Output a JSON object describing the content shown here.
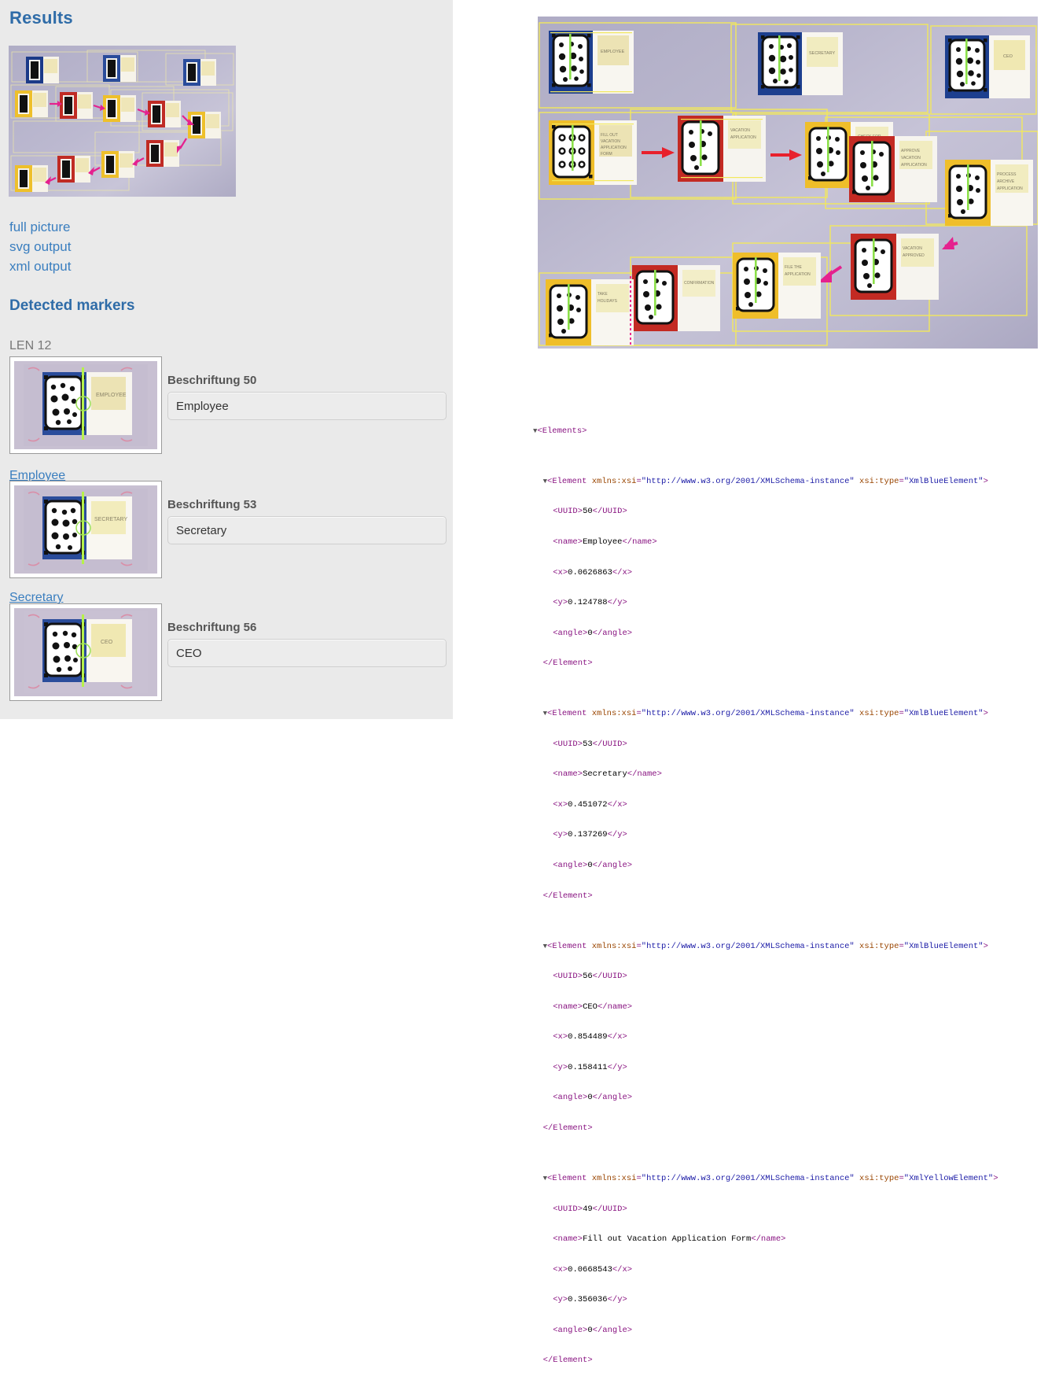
{
  "left_panel": {
    "heading_results": "Results",
    "heading_detected": "Detected markers",
    "len_label": "LEN 12",
    "links": [
      {
        "label": "full picture",
        "name": "full-picture"
      },
      {
        "label": "svg output",
        "name": "svg-output"
      },
      {
        "label": "xml output",
        "name": "xml-output"
      }
    ],
    "markers": [
      {
        "field_label": "Beschriftung 50",
        "value": "Employee",
        "caption_link": "Employee"
      },
      {
        "field_label": "Beschriftung 53",
        "value": "Secretary",
        "caption_link": "Secretary"
      },
      {
        "field_label": "Beschriftung 56",
        "value": "CEO",
        "caption_link": ""
      }
    ]
  },
  "board": {
    "marker_texts": [
      "EMPLOYEE",
      "SECRETARY",
      "CEO",
      "FILL OUT VACATION APPLICATION FORM",
      "VACATION APPLICATION",
      "CHECK FOR CONFLICTS",
      "APPROVE VACATION APPLICATION",
      "PROCESS ARCHIVE APPLICATION",
      "VACATION APPROVED",
      "FILE THE APPLICATION",
      "CONFIRMATION",
      "TAKE HOLIDAYS"
    ]
  },
  "xml": {
    "root_open": "<Elements>",
    "elements": [
      {
        "open": "<Element xmlns:xsi=\"http://www.w3.org/2001/XMLSchema-instance\" xsi:type=\"XmlBlueElement\">",
        "ns_attr": "xmlns:xsi",
        "ns_value": "\"http://www.w3.org/2001/XMLSchema-instance\"",
        "type_attr": "xsi:type",
        "type_value": "\"XmlBlueElement\"",
        "uuid": "50",
        "name": "Employee",
        "x": "0.0626863",
        "y": "0.124788",
        "angle": "0",
        "close": "</Element>"
      },
      {
        "ns_attr": "xmlns:xsi",
        "ns_value": "\"http://www.w3.org/2001/XMLSchema-instance\"",
        "type_attr": "xsi:type",
        "type_value": "\"XmlBlueElement\"",
        "uuid": "53",
        "name": "Secretary",
        "x": "0.451072",
        "y": "0.137269",
        "angle": "0",
        "close": "</Element>"
      },
      {
        "ns_attr": "xmlns:xsi",
        "ns_value": "\"http://www.w3.org/2001/XMLSchema-instance\"",
        "type_attr": "xsi:type",
        "type_value": "\"XmlBlueElement\"",
        "uuid": "56",
        "name": "CEO",
        "x": "0.854489",
        "y": "0.158411",
        "angle": "0",
        "close": "</Element>"
      },
      {
        "ns_attr": "xmlns:xsi",
        "ns_value": "\"http://www.w3.org/2001/XMLSchema-instance\"",
        "type_attr": "xsi:type",
        "type_value": "\"XmlYellowElement\"",
        "uuid": "49",
        "name": "Fill out Vacation Application Form",
        "x": "0.0668543",
        "y": "0.356036",
        "angle": "0",
        "close": "</Element>"
      }
    ],
    "triangle": "▼",
    "tag_element": "Element",
    "tag_uuid": "UUID",
    "tag_name": "name",
    "tag_x": "x",
    "tag_y": "y",
    "tag_angle": "angle"
  },
  "colors": {
    "heading_blue": "#2f6ca8",
    "link_blue": "#3a7ebf",
    "panel_bg": "#eaeaea",
    "detect_yellow": "#f2e85c",
    "arrow_red": "#e8202c",
    "arrow_pink": "#e5218e"
  }
}
